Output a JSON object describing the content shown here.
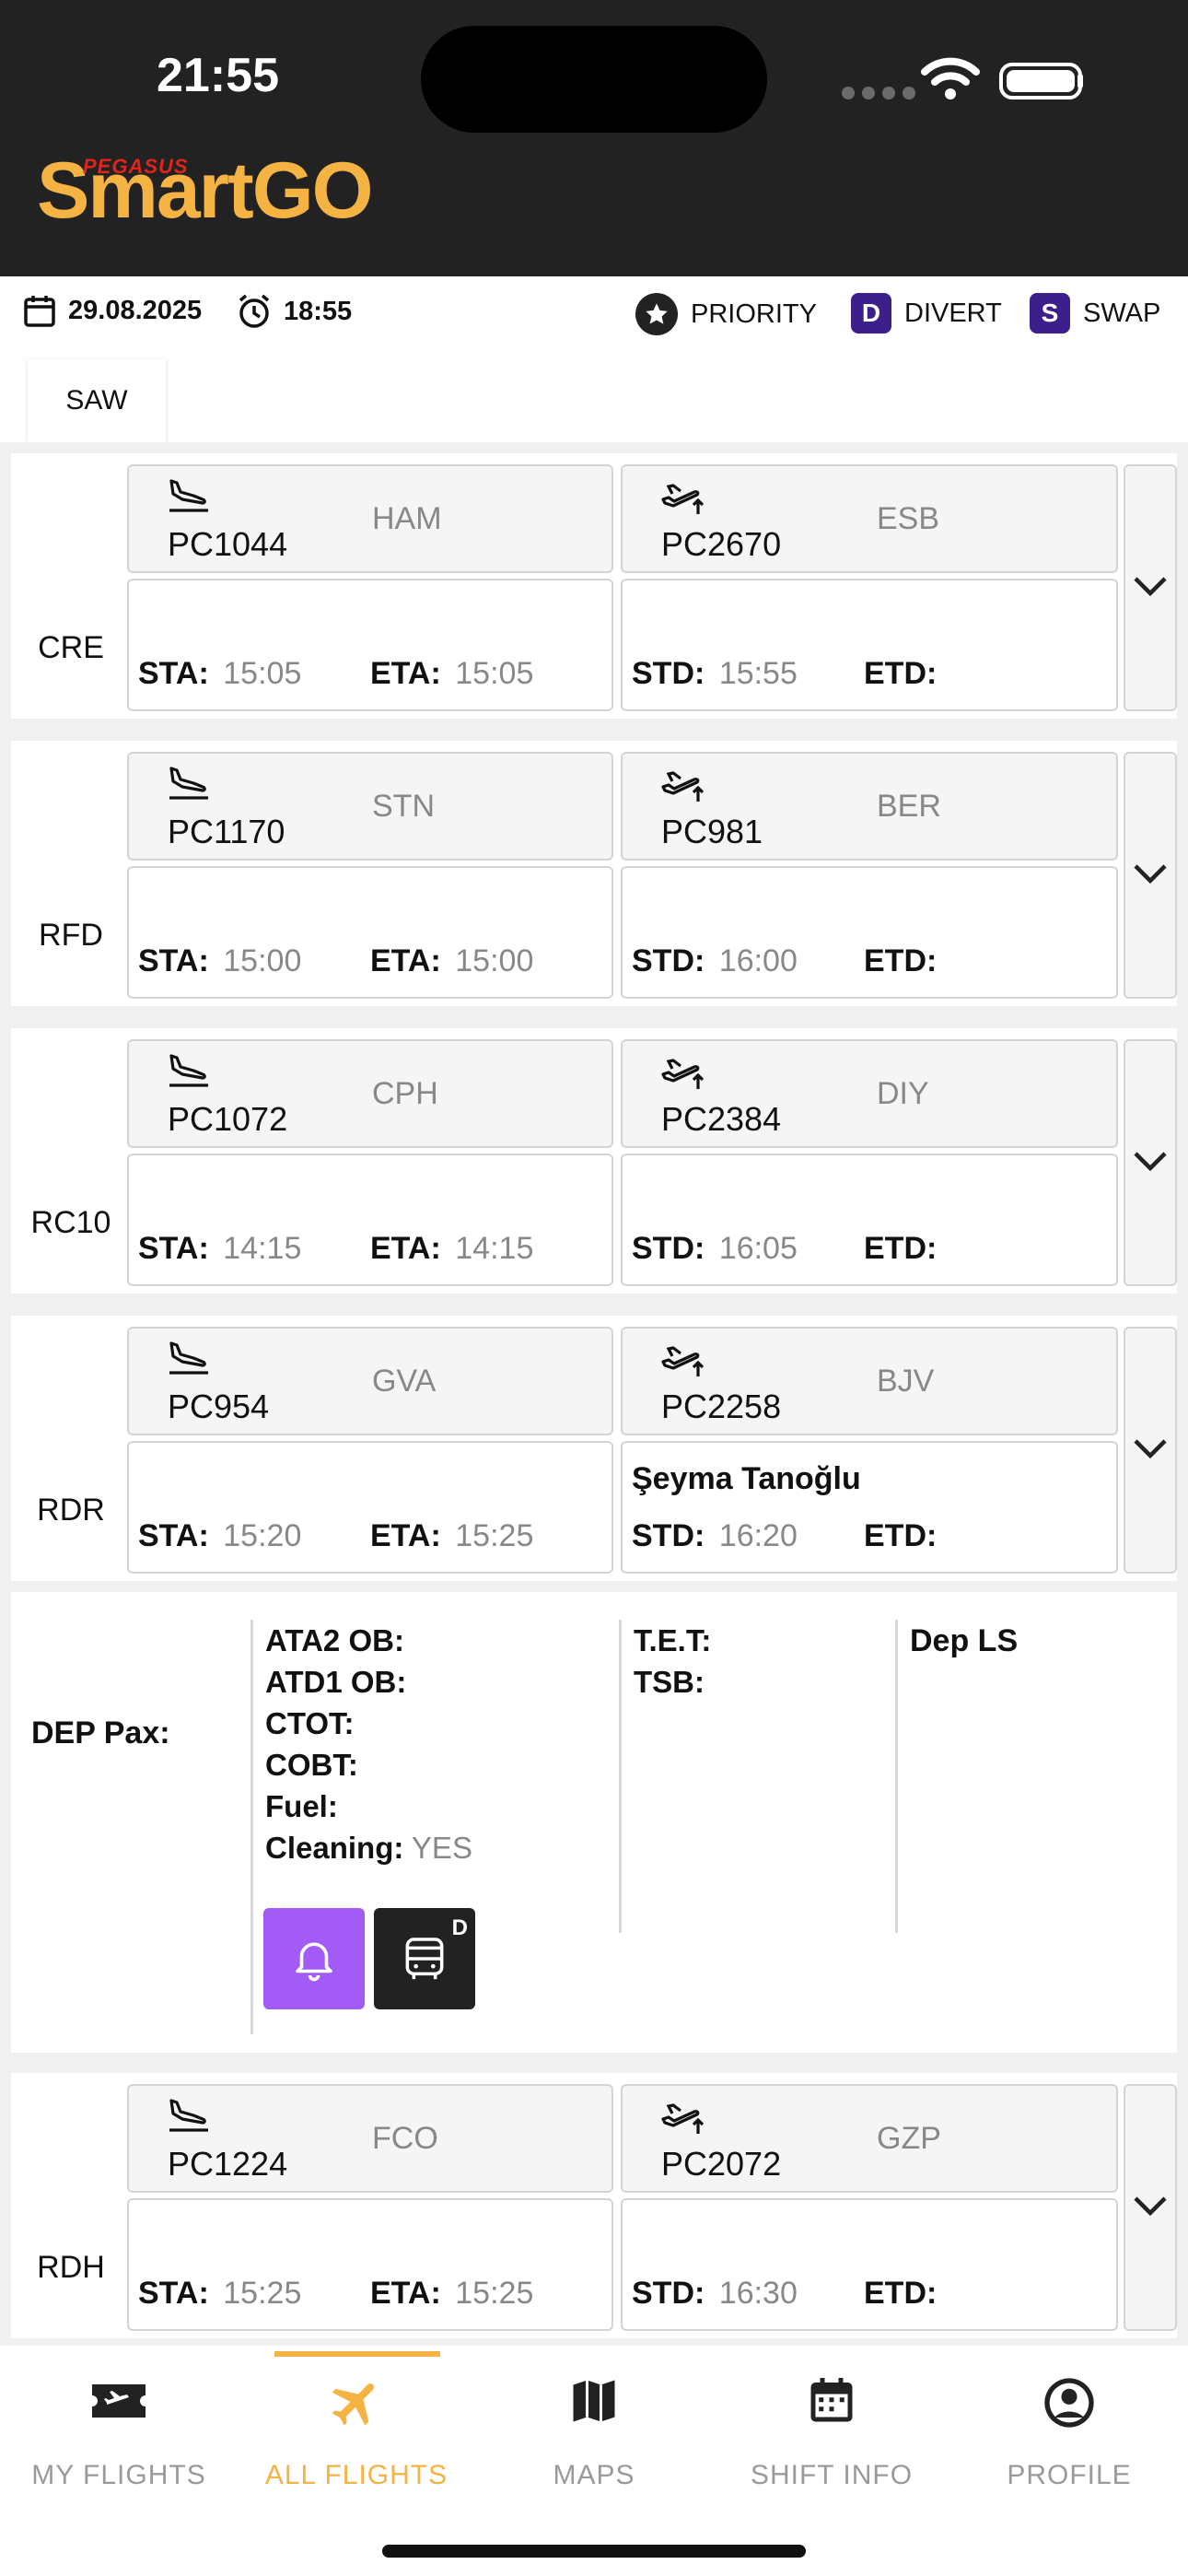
{
  "status_bar": {
    "time": "21:55"
  },
  "app": {
    "brand_small": "PEGASUS",
    "brand_main": "SmartGO"
  },
  "info_bar": {
    "date": "29.08.2025",
    "time": "18:55",
    "legend": [
      {
        "key": "priority",
        "label": "PRIORITY"
      },
      {
        "key": "divert",
        "letter": "D",
        "label": "DIVERT"
      },
      {
        "key": "swap",
        "letter": "S",
        "label": "SWAP"
      }
    ]
  },
  "station_tab": "SAW",
  "labels": {
    "sta": "STA:",
    "eta": "ETA:",
    "std": "STD:",
    "etd": "ETD:"
  },
  "flights": [
    {
      "stand": "CRE",
      "arr_flight": "PC1044",
      "arr_airport": "HAM",
      "sta": "15:05",
      "eta": "15:05",
      "dep_flight": "PC2670",
      "dep_airport": "ESB",
      "std": "15:55",
      "etd": "",
      "agent": ""
    },
    {
      "stand": "RFD",
      "arr_flight": "PC1170",
      "arr_airport": "STN",
      "sta": "15:00",
      "eta": "15:00",
      "dep_flight": "PC981",
      "dep_airport": "BER",
      "std": "16:00",
      "etd": "",
      "agent": ""
    },
    {
      "stand": "RC10",
      "arr_flight": "PC1072",
      "arr_airport": "CPH",
      "sta": "14:15",
      "eta": "14:15",
      "dep_flight": "PC2384",
      "dep_airport": "DIY",
      "std": "16:05",
      "etd": "",
      "agent": ""
    },
    {
      "stand": "RDR",
      "arr_flight": "PC954",
      "arr_airport": "GVA",
      "sta": "15:20",
      "eta": "15:25",
      "dep_flight": "PC2258",
      "dep_airport": "BJV",
      "std": "16:20",
      "etd": "",
      "agent": "Şeyma Tanoğlu"
    },
    {
      "stand": "RDH",
      "arr_flight": "PC1224",
      "arr_airport": "FCO",
      "sta": "15:25",
      "eta": "15:25",
      "dep_flight": "PC2072",
      "dep_airport": "GZP",
      "std": "16:30",
      "etd": "",
      "agent": ""
    }
  ],
  "detail": {
    "title": "DEP Pax:",
    "col1": [
      {
        "label": "ATA2 OB:",
        "value": ""
      },
      {
        "label": "ATD1 OB:",
        "value": ""
      },
      {
        "label": "CTOT:",
        "value": ""
      },
      {
        "label": "COBT:",
        "value": ""
      },
      {
        "label": "Fuel:",
        "value": ""
      },
      {
        "label": "Cleaning:",
        "value": "YES"
      }
    ],
    "col2": [
      {
        "label": "T.E.T:",
        "value": ""
      },
      {
        "label": "TSB:",
        "value": ""
      }
    ],
    "col3_title": "Dep LS",
    "bus_badge": "D"
  },
  "bottom_nav": [
    {
      "label": "MY FLIGHTS",
      "icon": "ticket-plane-icon",
      "active": false
    },
    {
      "label": "ALL FLIGHTS",
      "icon": "airplane-icon",
      "active": true
    },
    {
      "label": "MAPS",
      "icon": "map-icon",
      "active": false
    },
    {
      "label": "SHIFT INFO",
      "icon": "calendar-icon",
      "active": false
    },
    {
      "label": "PROFILE",
      "icon": "user-circle-icon",
      "active": false
    }
  ],
  "colors": {
    "header_bg": "#222222",
    "brand_yellow": "#f4b342",
    "brand_red": "#e2231a",
    "badge_purple": "#3d1f8c",
    "bell_purple": "#a25cf5"
  }
}
